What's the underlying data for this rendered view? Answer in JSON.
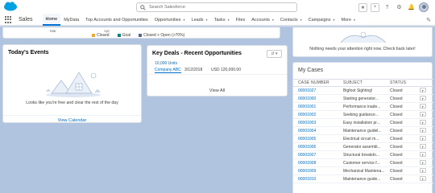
{
  "header": {
    "search_placeholder": "Search Salesforce",
    "logo_name": "salesforce-cloud-logo",
    "icons": [
      "star-icon",
      "add-icon",
      "help-icon",
      "gear-icon",
      "bell-icon",
      "avatar"
    ]
  },
  "nav": {
    "app_name": "Sales",
    "tabs": [
      {
        "label": "Home",
        "active": true,
        "has_menu": false
      },
      {
        "label": "MyData",
        "active": false,
        "has_menu": false
      },
      {
        "label": "Top Accounts and Opportunities",
        "active": false,
        "has_menu": false
      },
      {
        "label": "Opportunities",
        "active": false,
        "has_menu": true
      },
      {
        "label": "Leads",
        "active": false,
        "has_menu": true
      },
      {
        "label": "Tasks",
        "active": false,
        "has_menu": true
      },
      {
        "label": "Files",
        "active": false,
        "has_menu": false
      },
      {
        "label": "Accounts",
        "active": false,
        "has_menu": true
      },
      {
        "label": "Contacts",
        "active": false,
        "has_menu": true
      },
      {
        "label": "Campaigns",
        "active": false,
        "has_menu": true
      },
      {
        "label": "More",
        "active": false,
        "has_menu": true
      }
    ]
  },
  "performance_legend": {
    "years": [
      "Mar",
      "Apr"
    ],
    "items": [
      {
        "label": "Closed",
        "color": "#f4a724"
      },
      {
        "label": "Goal",
        "color": "#0b827c"
      },
      {
        "label": "Closed + Open (>70%)",
        "color": "#54698d"
      }
    ]
  },
  "todays_events": {
    "title": "Today's Events",
    "message": "Looks like you're free and clear the rest of the day",
    "link": "View Calendar"
  },
  "key_deals": {
    "title": "Key Deals - Recent Opportunities",
    "filter_icon": "filter-icon",
    "deal": {
      "name": "10,000 Units",
      "account": "Company ABC",
      "date": "3/12/2018",
      "amount": "USD 120,000.00"
    },
    "view_all": "View All"
  },
  "assistant": {
    "message": "Nothing needs your attention right now. Check back later!"
  },
  "my_cases": {
    "title": "My Cases",
    "columns": [
      "CASE NUMBER",
      "SUBJECT",
      "STATUS"
    ],
    "rows": [
      {
        "number": "00001027",
        "subject": "Bigfoot Sighting!",
        "status": "Closed"
      },
      {
        "number": "00001000",
        "subject": "Starting generator...",
        "status": "Closed"
      },
      {
        "number": "00001001",
        "subject": "Performance inade...",
        "status": "Closed"
      },
      {
        "number": "00001002",
        "subject": "Seeking guidance...",
        "status": "Closed"
      },
      {
        "number": "00001003",
        "subject": "Easy installation pr...",
        "status": "Closed"
      },
      {
        "number": "00001004",
        "subject": "Maintenance guidel...",
        "status": "Closed"
      },
      {
        "number": "00001005",
        "subject": "Electrical circuit m...",
        "status": "Closed"
      },
      {
        "number": "00001006",
        "subject": "Generator assembl...",
        "status": "Closed"
      },
      {
        "number": "00001007",
        "subject": "Structural breakdo...",
        "status": "Closed"
      },
      {
        "number": "00001008",
        "subject": "Customer service f...",
        "status": "Closed"
      },
      {
        "number": "00001009",
        "subject": "Mechanical Maintena...",
        "status": "Closed"
      },
      {
        "number": "00001010",
        "subject": "Maintenance guide...",
        "status": "Closed"
      }
    ]
  }
}
